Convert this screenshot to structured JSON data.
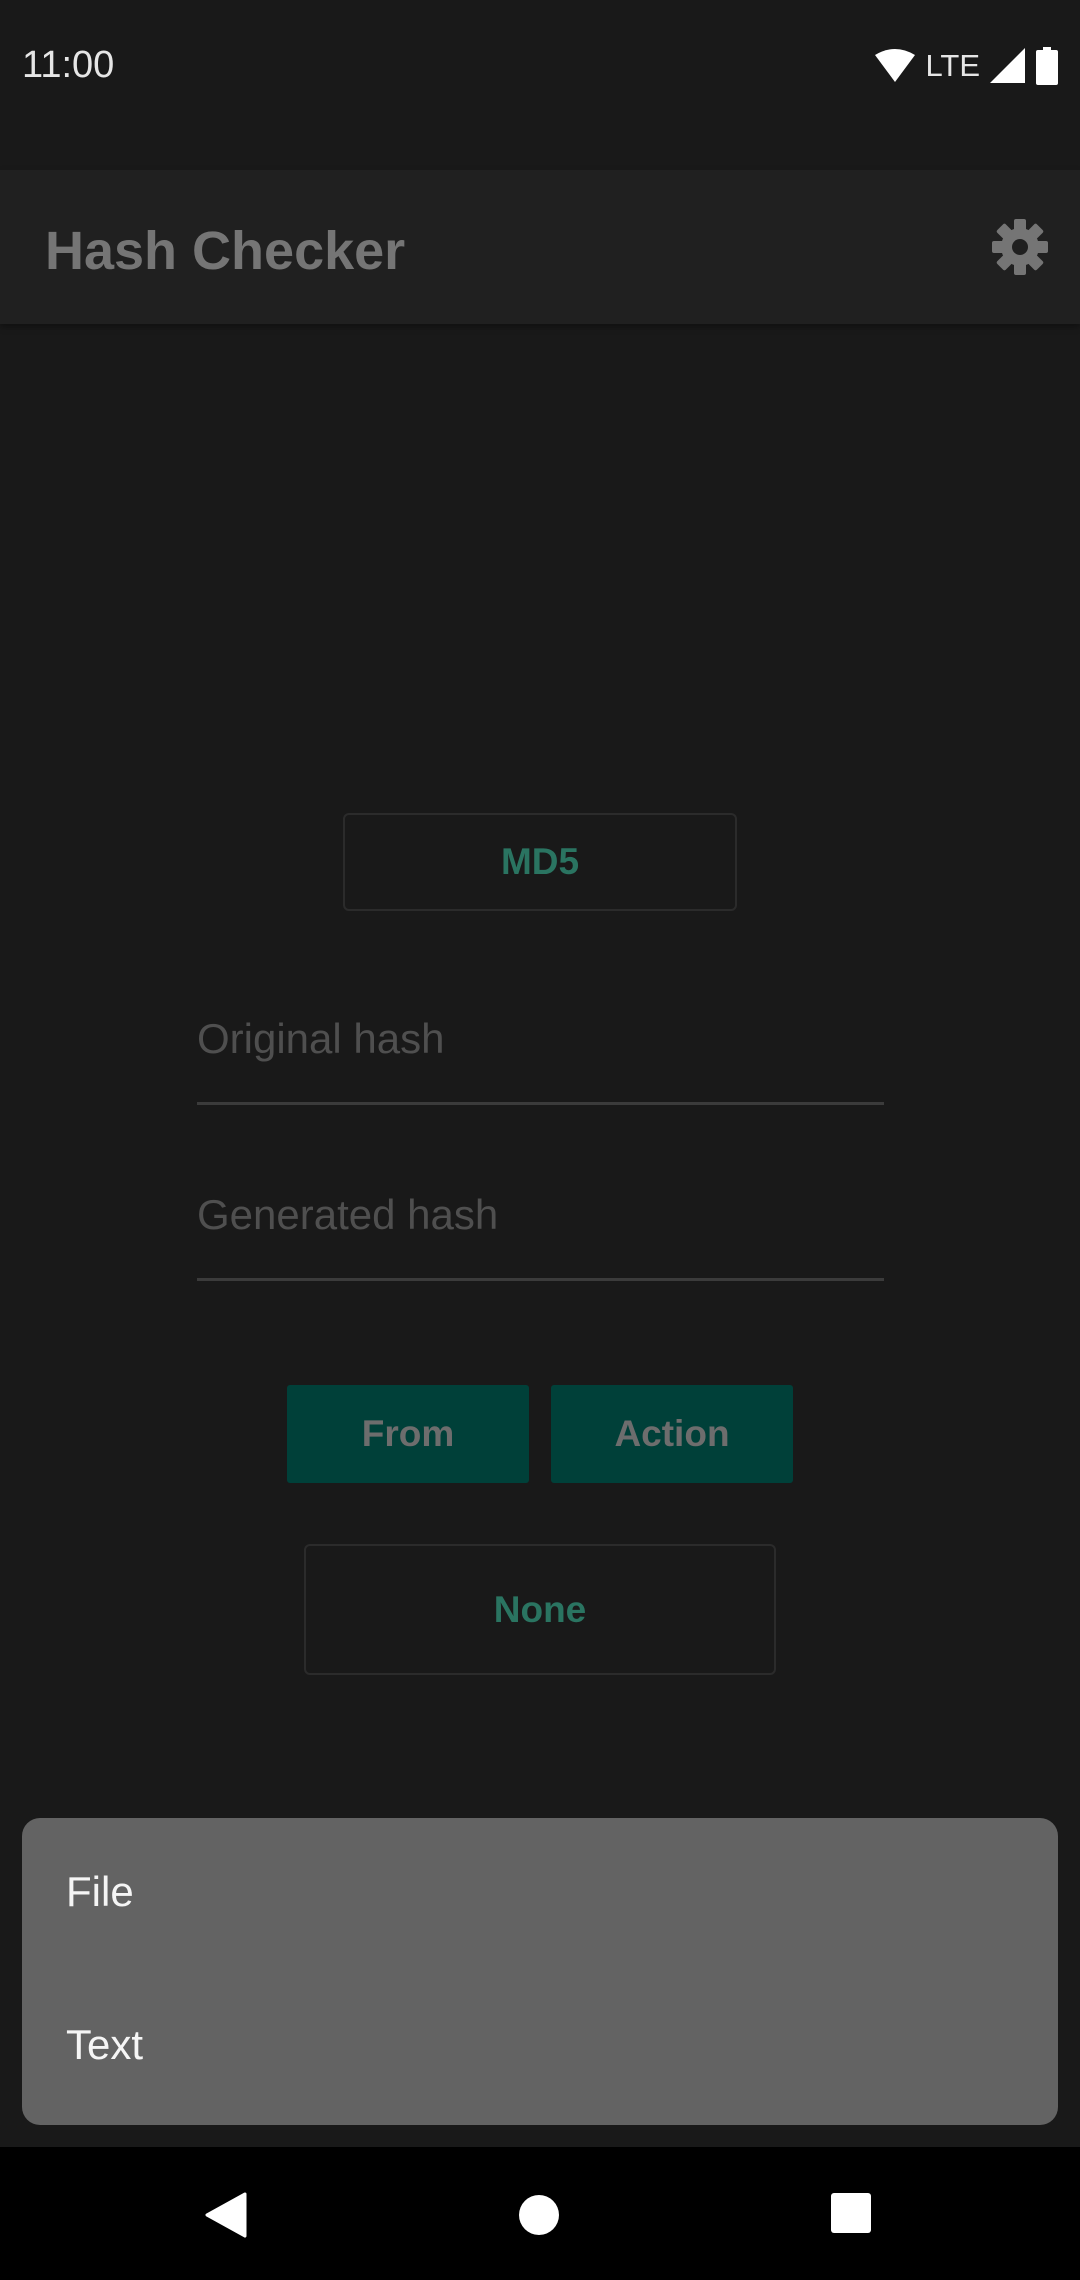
{
  "status_bar": {
    "time": "11:00",
    "network": "LTE",
    "icons": [
      "wifi-icon",
      "signal-icon",
      "battery-icon"
    ]
  },
  "app_bar": {
    "title": "Hash Checker",
    "settings_icon": "gear-icon"
  },
  "main": {
    "algorithm_button": "MD5",
    "original_hash_placeholder": "Original hash",
    "generated_hash_placeholder": "Generated hash",
    "from_button": "From",
    "action_button": "Action",
    "result_button": "None"
  },
  "popup_menu": {
    "items": [
      {
        "label": "File"
      },
      {
        "label": "Text"
      }
    ]
  },
  "nav_bar": {
    "icons": [
      "back-icon",
      "home-icon",
      "recents-icon"
    ]
  },
  "colors": {
    "background": "#191919",
    "app_bar": "#202020",
    "accent_text": "#2a7461",
    "button_fill": "#004039",
    "menu_background": "#636363"
  }
}
